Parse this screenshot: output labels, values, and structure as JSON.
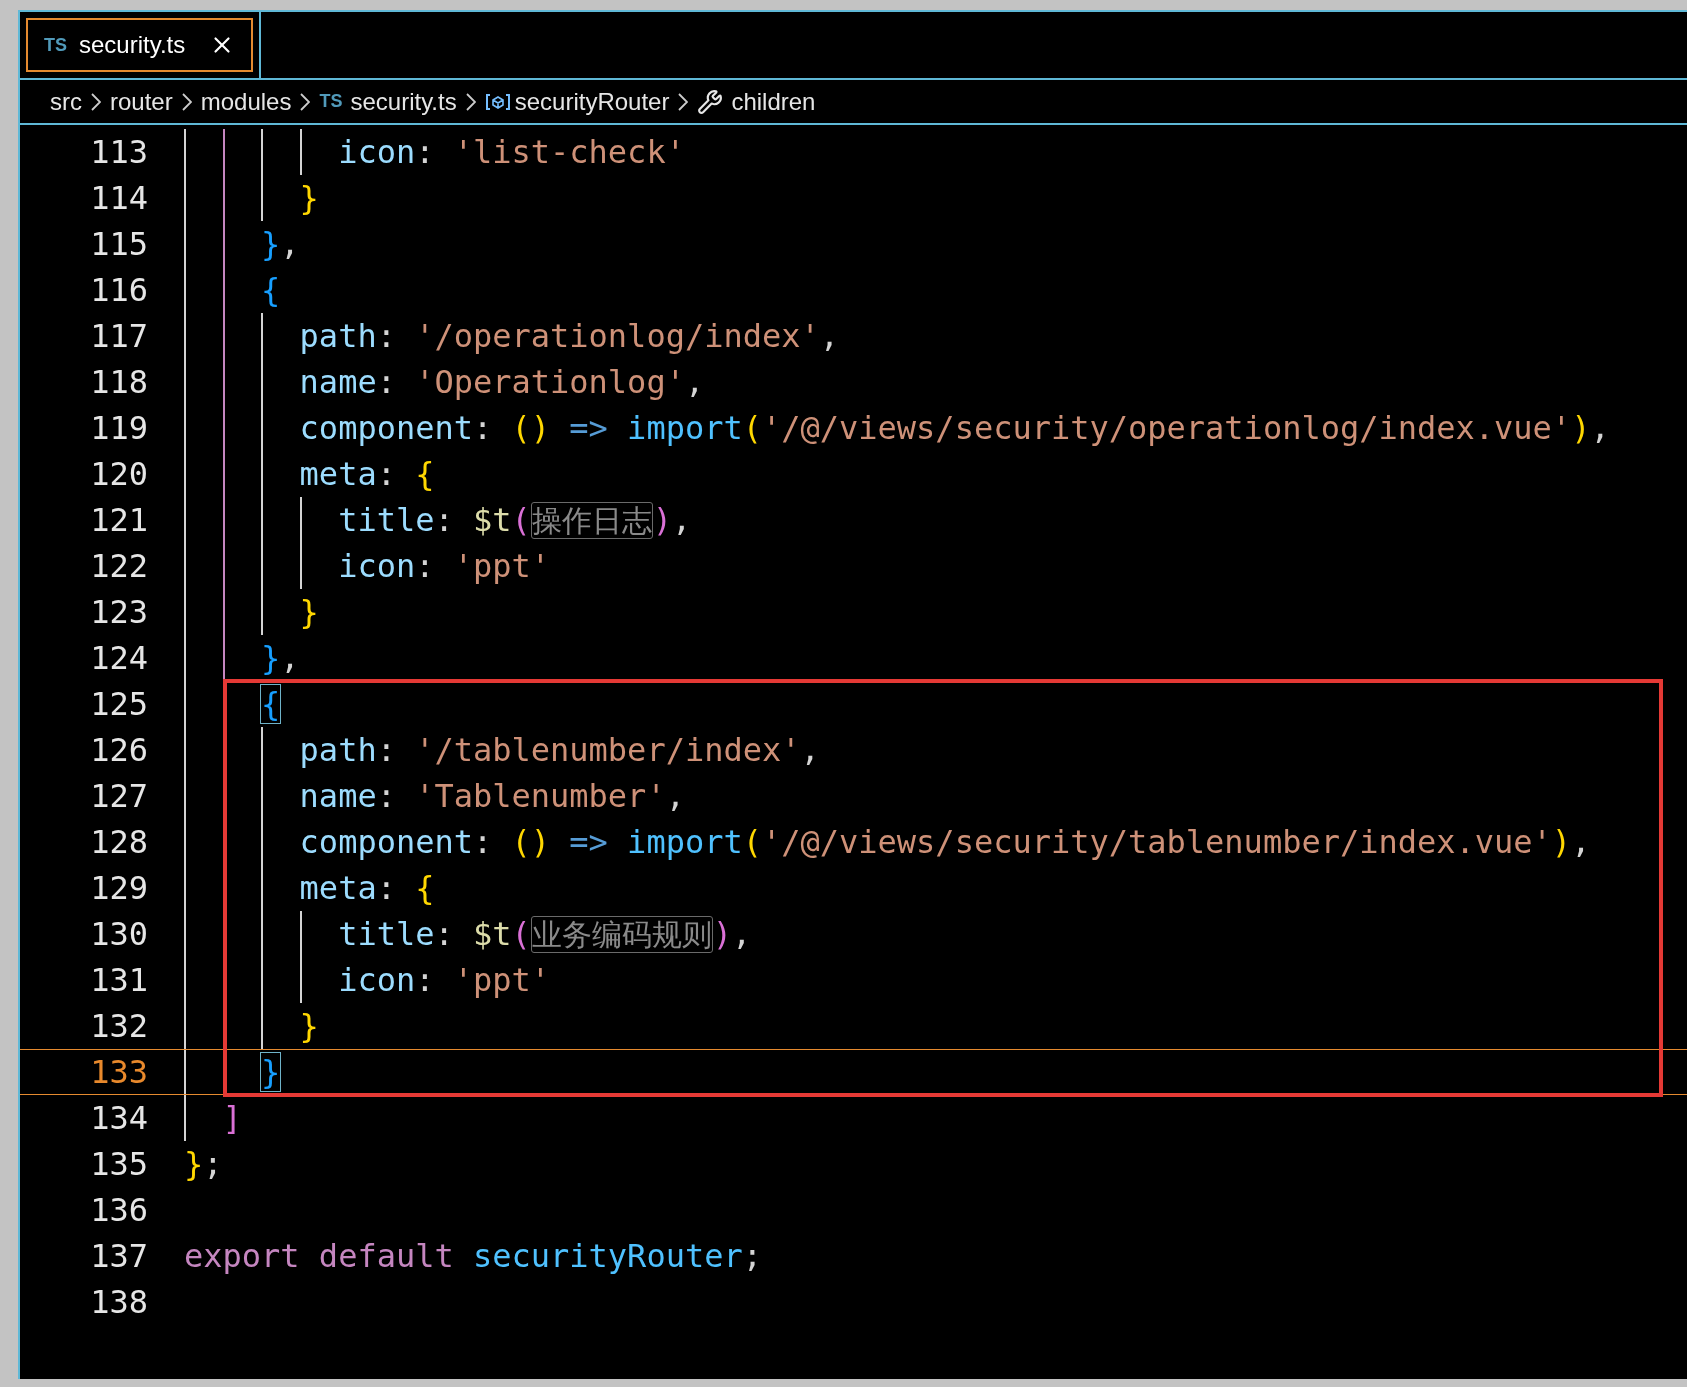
{
  "tabs": [
    {
      "badge": "TS",
      "label": "security.ts",
      "selected": true
    }
  ],
  "breadcrumb": [
    {
      "kind": "folder",
      "label": "src"
    },
    {
      "kind": "folder",
      "label": "router"
    },
    {
      "kind": "folder",
      "label": "modules"
    },
    {
      "kind": "file",
      "badge": "TS",
      "label": "security.ts"
    },
    {
      "kind": "variable",
      "label": "securityRouter"
    },
    {
      "kind": "property",
      "label": "children"
    }
  ],
  "code": [
    {
      "kind": "plain",
      "lines": [
        {
          "number": "113",
          "current": false,
          "tokens": [
            {
              "kind": "key",
              "text": "        icon"
            },
            {
              "kind": "punct",
              "text": ": "
            },
            {
              "kind": "string",
              "text": "'list-check'"
            }
          ]
        },
        {
          "number": "114",
          "current": false,
          "tokens": [
            {
              "kind": "bracket-a",
              "text": "      }"
            }
          ]
        },
        {
          "number": "115",
          "current": false,
          "tokens": [
            {
              "kind": "bracket-c",
              "text": "    }"
            },
            {
              "kind": "punct",
              "text": ","
            }
          ]
        },
        {
          "number": "116",
          "current": false,
          "tokens": [
            {
              "kind": "bracket-c",
              "text": "    {"
            }
          ]
        },
        {
          "number": "117",
          "current": false,
          "tokens": [
            {
              "kind": "key",
              "text": "      path"
            },
            {
              "kind": "punct",
              "text": ": "
            },
            {
              "kind": "string",
              "text": "'/operationlog/index'"
            },
            {
              "kind": "punct",
              "text": ","
            }
          ]
        },
        {
          "number": "118",
          "current": false,
          "tokens": [
            {
              "kind": "key",
              "text": "      name"
            },
            {
              "kind": "punct",
              "text": ": "
            },
            {
              "kind": "string",
              "text": "'Operationlog'"
            },
            {
              "kind": "punct",
              "text": ","
            }
          ]
        },
        {
          "number": "119",
          "current": false,
          "tokens": [
            {
              "kind": "key",
              "text": "      component"
            },
            {
              "kind": "punct",
              "text": ": "
            },
            {
              "kind": "bracket-a",
              "text": "()"
            },
            {
              "kind": "op",
              "text": " => "
            },
            {
              "kind": "keyword",
              "text": "import"
            },
            {
              "kind": "bracket-a",
              "text": "("
            },
            {
              "kind": "string",
              "text": "'/@/views/security/operationlog/index.vue'"
            },
            {
              "kind": "bracket-a",
              "text": ")"
            },
            {
              "kind": "punct",
              "text": ","
            }
          ]
        },
        {
          "number": "120",
          "current": false,
          "tokens": [
            {
              "kind": "key",
              "text": "      meta"
            },
            {
              "kind": "punct",
              "text": ": "
            },
            {
              "kind": "bracket-a",
              "text": "{"
            }
          ]
        },
        {
          "number": "121",
          "current": false,
          "tokens": [
            {
              "kind": "key",
              "text": "        title"
            },
            {
              "kind": "punct",
              "text": ": "
            },
            {
              "kind": "func",
              "text": "$t"
            },
            {
              "kind": "bracket-b",
              "text": "("
            },
            {
              "kind": "hint",
              "text": "操作日志"
            },
            {
              "kind": "bracket-b",
              "text": ")"
            },
            {
              "kind": "punct",
              "text": ","
            }
          ]
        },
        {
          "number": "122",
          "current": false,
          "tokens": [
            {
              "kind": "key",
              "text": "        icon"
            },
            {
              "kind": "punct",
              "text": ": "
            },
            {
              "kind": "string",
              "text": "'ppt'"
            }
          ]
        },
        {
          "number": "123",
          "current": false,
          "tokens": [
            {
              "kind": "bracket-a",
              "text": "      }"
            }
          ]
        },
        {
          "number": "124",
          "current": false,
          "tokens": [
            {
              "kind": "bracket-c",
              "text": "    }"
            },
            {
              "kind": "punct",
              "text": ","
            }
          ]
        }
      ]
    },
    {
      "kind": "highlight",
      "lines": [
        {
          "number": "125",
          "current": false,
          "tokens": [
            {
              "kind": "bracket-match",
              "text": "    {"
            }
          ]
        },
        {
          "number": "126",
          "current": false,
          "tokens": [
            {
              "kind": "key",
              "text": "      path"
            },
            {
              "kind": "punct",
              "text": ": "
            },
            {
              "kind": "string",
              "text": "'/tablenumber/index'"
            },
            {
              "kind": "punct",
              "text": ","
            }
          ]
        },
        {
          "number": "127",
          "current": false,
          "tokens": [
            {
              "kind": "key",
              "text": "      name"
            },
            {
              "kind": "punct",
              "text": ": "
            },
            {
              "kind": "string",
              "text": "'Tablenumber'"
            },
            {
              "kind": "punct",
              "text": ","
            }
          ]
        },
        {
          "number": "128",
          "current": false,
          "tokens": [
            {
              "kind": "key",
              "text": "      component"
            },
            {
              "kind": "punct",
              "text": ": "
            },
            {
              "kind": "bracket-a",
              "text": "()"
            },
            {
              "kind": "op",
              "text": " => "
            },
            {
              "kind": "keyword",
              "text": "import"
            },
            {
              "kind": "bracket-a",
              "text": "("
            },
            {
              "kind": "string",
              "text": "'/@/views/security/tablenumber/index.vue'"
            },
            {
              "kind": "bracket-a",
              "text": ")"
            },
            {
              "kind": "punct",
              "text": ","
            }
          ]
        },
        {
          "number": "129",
          "current": false,
          "tokens": [
            {
              "kind": "key",
              "text": "      meta"
            },
            {
              "kind": "punct",
              "text": ": "
            },
            {
              "kind": "bracket-a",
              "text": "{"
            }
          ]
        },
        {
          "number": "130",
          "current": false,
          "tokens": [
            {
              "kind": "key",
              "text": "        title"
            },
            {
              "kind": "punct",
              "text": ": "
            },
            {
              "kind": "func",
              "text": "$t"
            },
            {
              "kind": "bracket-b",
              "text": "("
            },
            {
              "kind": "hint",
              "text": "业务编码规则"
            },
            {
              "kind": "bracket-b",
              "text": ")"
            },
            {
              "kind": "punct",
              "text": ","
            }
          ]
        },
        {
          "number": "131",
          "current": false,
          "tokens": [
            {
              "kind": "key",
              "text": "        icon"
            },
            {
              "kind": "punct",
              "text": ": "
            },
            {
              "kind": "string",
              "text": "'ppt'"
            }
          ]
        },
        {
          "number": "132",
          "current": false,
          "tokens": [
            {
              "kind": "bracket-a",
              "text": "      }"
            }
          ]
        },
        {
          "number": "133",
          "current": true,
          "tokens": [
            {
              "kind": "bracket-match",
              "text": "    }"
            }
          ]
        }
      ]
    },
    {
      "kind": "plain",
      "lines": [
        {
          "number": "134",
          "current": false,
          "tokens": [
            {
              "kind": "bracket-b",
              "text": "  ]"
            }
          ]
        },
        {
          "number": "135",
          "current": false,
          "tokens": [
            {
              "kind": "bracket-a",
              "text": "}"
            },
            {
              "kind": "punct",
              "text": ";"
            }
          ]
        },
        {
          "number": "136",
          "current": false
        },
        {
          "number": "137",
          "current": false,
          "tokens": [
            {
              "kind": "keyword2",
              "text": "export default"
            },
            {
              "kind": "var",
              "text": " securityRouter"
            },
            {
              "kind": "punct",
              "text": ";"
            }
          ]
        },
        {
          "number": "138",
          "current": false
        }
      ]
    }
  ]
}
